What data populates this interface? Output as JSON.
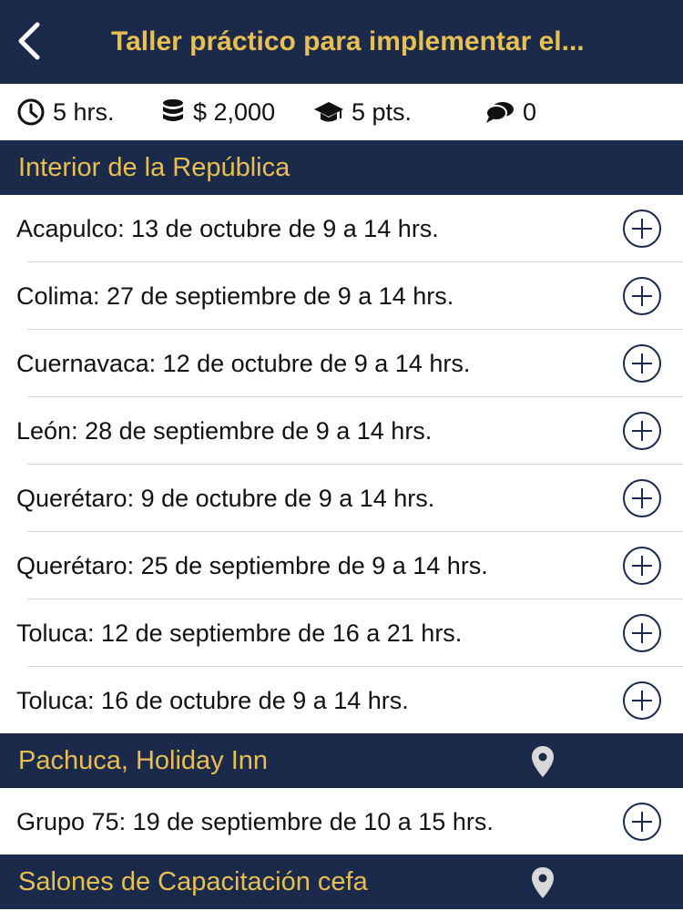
{
  "nav": {
    "title": "Taller práctico para implementar el...",
    "back_icon": "chevron-left-icon",
    "text_color": "#e7bf52",
    "bg_color": "#1b2a4a"
  },
  "meta": {
    "duration": "5 hrs.",
    "cost": "$ 2,000",
    "points": "5 pts.",
    "comments": "0"
  },
  "sections": [
    {
      "title": "Interior de la República",
      "items": [
        "Acapulco: 13 de octubre de 9 a 14 hrs.",
        "Colima: 27 de septiembre de 9 a 14 hrs.",
        "Cuernavaca: 12 de octubre de 9 a 14 hrs.",
        "León: 28 de septiembre de 9 a 14 hrs.",
        "Querétaro: 9 de octubre de 9 a 14 hrs.",
        "Querétaro: 25 de septiembre de 9 a 14 hrs.",
        "Toluca: 12 de septiembre de 16 a 21 hrs.",
        "Toluca: 16 de octubre de 9 a 14 hrs."
      ]
    },
    {
      "title": "Pachuca, Holiday Inn",
      "items": [
        "Grupo 75: 19 de septiembre de 10 a 15 hrs."
      ]
    },
    {
      "title": "Salones de Capacitación cefa",
      "items": []
    }
  ]
}
